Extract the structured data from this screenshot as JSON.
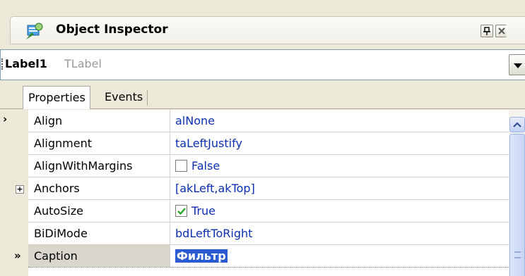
{
  "window": {
    "title": "Object Inspector"
  },
  "selector": {
    "name": "Label1",
    "type": "TLabel"
  },
  "tabs": [
    {
      "label": "Properties",
      "active": true
    },
    {
      "label": "Events",
      "active": false
    }
  ],
  "properties": [
    {
      "name": "Align",
      "value": "alNone"
    },
    {
      "name": "Alignment",
      "value": "taLeftJustify"
    },
    {
      "name": "AlignWithMargins",
      "value": "False",
      "checkbox": false
    },
    {
      "name": "Anchors",
      "value": "[akLeft,akTop]",
      "expandable": true
    },
    {
      "name": "AutoSize",
      "value": "True",
      "checkbox": true
    },
    {
      "name": "BiDiMode",
      "value": "bdLeftToRight"
    },
    {
      "name": "Caption",
      "value": "Фильтр",
      "selected": true
    }
  ],
  "colors": {
    "value_text": "#0b2fb0",
    "selection": "#2b5bd3",
    "checkmark": "#2aa82a"
  },
  "icons": [
    "object-inspector-icon",
    "pin-icon",
    "close-icon",
    "dropdown-arrow-icon",
    "expand-plus-icon",
    "scroll-up-icon",
    "current-row-marker-icon"
  ]
}
